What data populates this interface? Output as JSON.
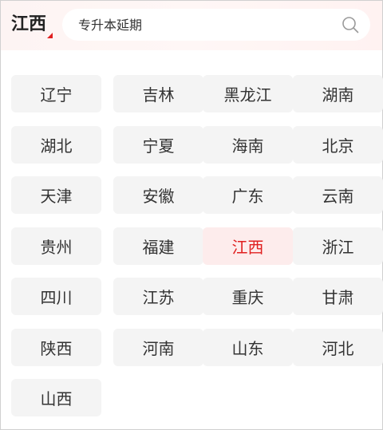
{
  "header": {
    "region": "江西",
    "search_placeholder": "专升本延期",
    "accent_color": "#e02020"
  },
  "provinces": [
    {
      "label": "辽宁",
      "selected": false
    },
    {
      "label": "吉林",
      "selected": false
    },
    {
      "label": "黑龙江",
      "selected": false
    },
    {
      "label": "湖南",
      "selected": false
    },
    {
      "label": "湖北",
      "selected": false
    },
    {
      "label": "宁夏",
      "selected": false
    },
    {
      "label": "海南",
      "selected": false
    },
    {
      "label": "北京",
      "selected": false
    },
    {
      "label": "天津",
      "selected": false
    },
    {
      "label": "安徽",
      "selected": false
    },
    {
      "label": "广东",
      "selected": false
    },
    {
      "label": "云南",
      "selected": false
    },
    {
      "label": "贵州",
      "selected": false
    },
    {
      "label": "福建",
      "selected": false
    },
    {
      "label": "江西",
      "selected": true
    },
    {
      "label": "浙江",
      "selected": false
    },
    {
      "label": "四川",
      "selected": false
    },
    {
      "label": "江苏",
      "selected": false
    },
    {
      "label": "重庆",
      "selected": false
    },
    {
      "label": "甘肃",
      "selected": false
    },
    {
      "label": "陕西",
      "selected": false
    },
    {
      "label": "河南",
      "selected": false
    },
    {
      "label": "山东",
      "selected": false
    },
    {
      "label": "河北",
      "selected": false
    },
    {
      "label": "山西",
      "selected": false
    }
  ]
}
